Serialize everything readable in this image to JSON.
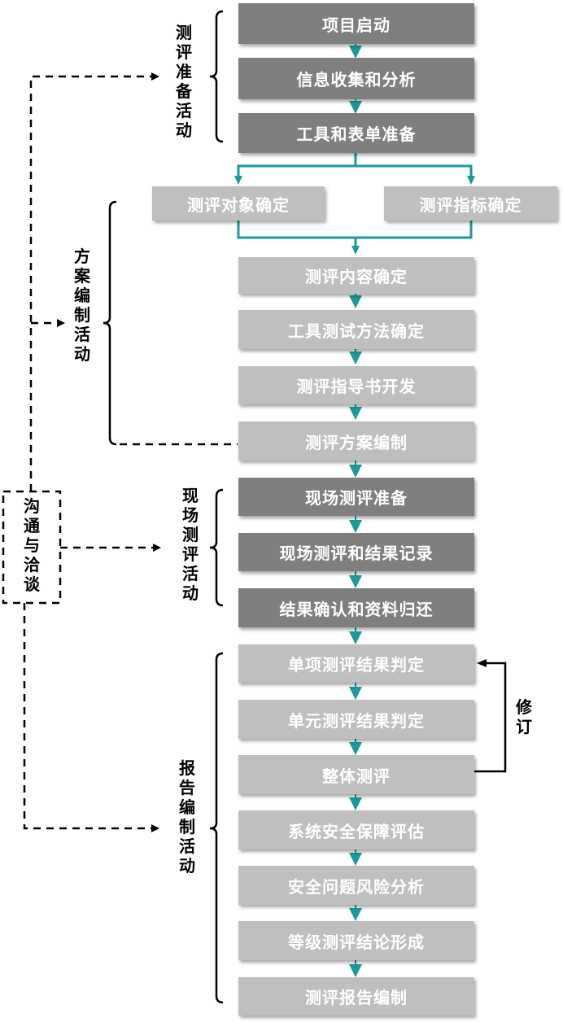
{
  "stages": {
    "prep": "测评准备活动",
    "plan": "方案编制活动",
    "field": "现场测评活动",
    "report": "报告编制活动"
  },
  "communication": "沟通与洽谈",
  "revision": "修订",
  "steps": {
    "s1": "项目启动",
    "s2": "信息收集和分析",
    "s3": "工具和表单准备",
    "s4a": "测评对象确定",
    "s4b": "测评指标确定",
    "s5": "测评内容确定",
    "s6": "工具测试方法确定",
    "s7": "测评指导书开发",
    "s8": "测评方案编制",
    "s9": "现场测评准备",
    "s10": "现场测评和结果记录",
    "s11": "结果确认和资料归还",
    "s12": "单项测评结果判定",
    "s13": "单元测评结果判定",
    "s14": "整体测评",
    "s15": "系统安全保障评估",
    "s16": "安全问题风险分析",
    "s17": "等级测评结论形成",
    "s18": "测评报告编制"
  },
  "colors": {
    "dark_box": "#7f7f7f",
    "light_box": "#bfbfbf",
    "arrow": "#1a9a9a"
  }
}
